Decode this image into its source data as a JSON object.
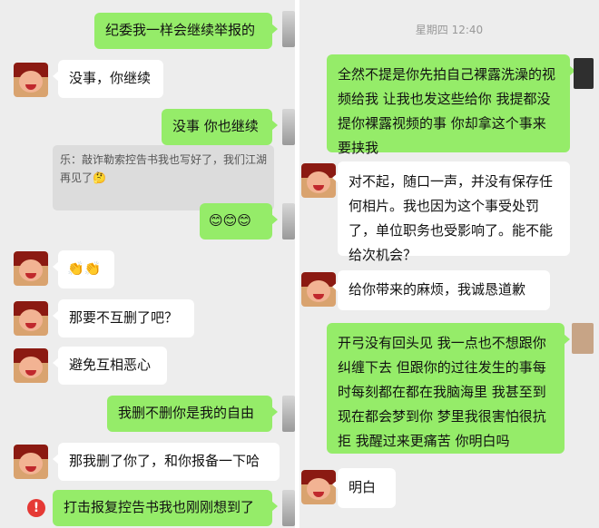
{
  "left": {
    "messages": [
      {
        "side": "right",
        "text": "纪委我一样会继续举报的"
      },
      {
        "side": "left",
        "text": "没事，你继续"
      },
      {
        "side": "right",
        "text": "没事 你也继续"
      },
      {
        "side": "quote",
        "text": "乐：敲诈勒索控告书我也写好了，我们江湖再见了🤔"
      },
      {
        "side": "right",
        "text": "😊😊😊"
      },
      {
        "side": "left",
        "text": "👏👏"
      },
      {
        "side": "left",
        "text": "那要不互删了吧？"
      },
      {
        "side": "left",
        "text": "避免互相恶心"
      },
      {
        "side": "right",
        "text": "我删不删你是我的自由"
      },
      {
        "side": "left",
        "text": "那我删了你了，和你报备一下哈"
      },
      {
        "side": "right",
        "text": "打击报复控告书我也刚刚想到了"
      }
    ]
  },
  "right": {
    "timestamp": "星期四 12:40",
    "messages": [
      {
        "side": "right",
        "text": "全然不提是你先拍自己裸露洗澡的视频给我 让我也发这些给你 我提都没提你裸露视频的事 你却拿这个事来要挟我"
      },
      {
        "side": "left",
        "text": "对不起，随口一声，并没有保存任何相片。我也因为这个事受处罚了，单位职务也受影响了。能不能给次机会？"
      },
      {
        "side": "left",
        "text": "给你带来的麻烦，我诚恳道歉"
      },
      {
        "side": "right",
        "text": "开弓没有回头见 我一点也不想跟你纠缠下去 但跟你的过往发生的事每时每刻都在都在我脑海里 我甚至到现在都会梦到你 梦里我很害怕很抗拒 我醒过来更痛苦 你明白吗"
      },
      {
        "side": "left",
        "text": "明白"
      }
    ]
  }
}
